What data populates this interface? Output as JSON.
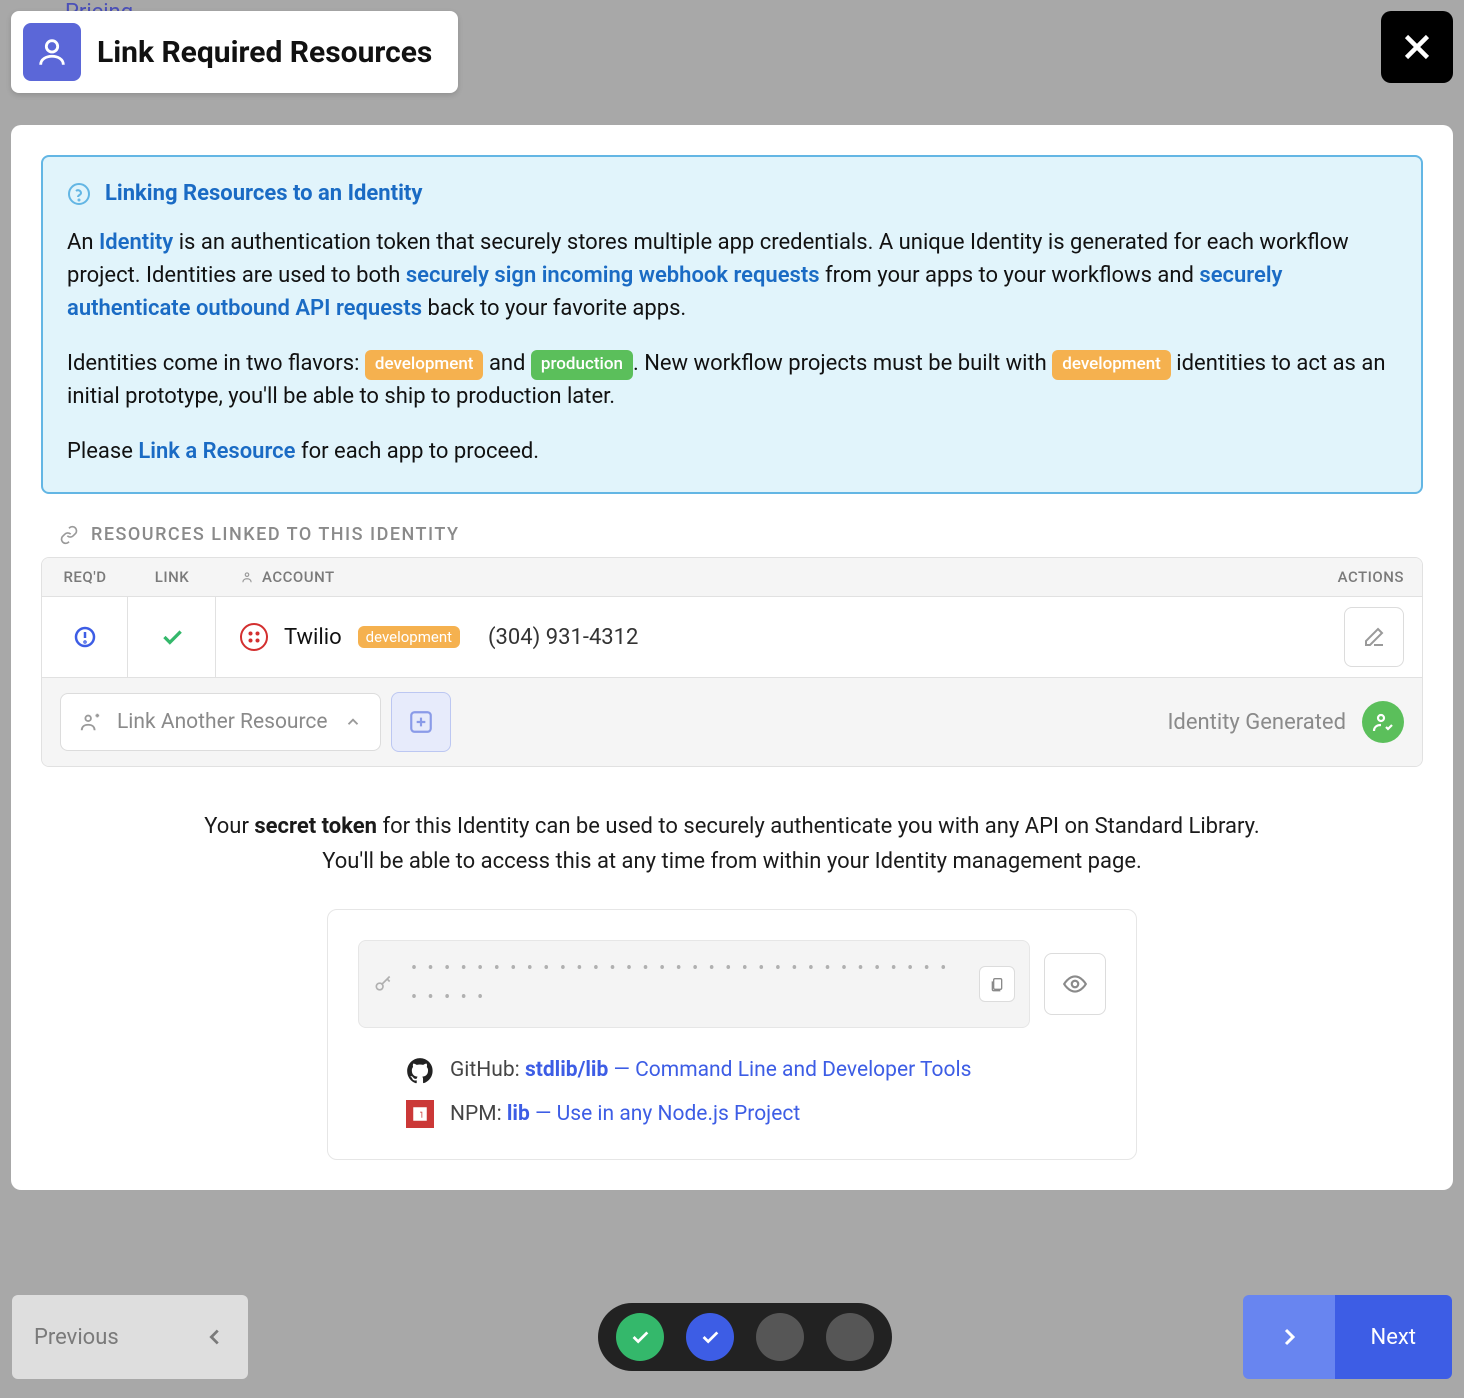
{
  "bg": {
    "pricing": "Pricing"
  },
  "modal": {
    "title": "Link Required Resources"
  },
  "info": {
    "title": "Linking Resources to an Identity",
    "p1_a": "An ",
    "p1_identity": "Identity",
    "p1_b": " is an authentication token that securely stores multiple app credentials. A unique Identity is generated for each workflow project. Identities are used to both ",
    "p1_link1": "securely sign incoming webhook requests",
    "p1_c": " from your apps to your workflows and ",
    "p1_link2": "securely authenticate outbound API requests",
    "p1_d": " back to your favorite apps.",
    "p2_a": "Identities come in two flavors: ",
    "p2_b": " and ",
    "p2_c": ". New workflow projects must be built with ",
    "p2_d": " identities to act as an initial prototype, you'll be able to ship to production later.",
    "p3_a": "Please ",
    "p3_link": "Link a Resource",
    "p3_b": " for each app to proceed.",
    "pill_dev": "development",
    "pill_prod": "production"
  },
  "section": {
    "title": "RESOURCES LINKED TO THIS IDENTITY"
  },
  "table": {
    "headers": {
      "req": "REQ'D",
      "link": "LINK",
      "account": "ACCOUNT",
      "actions": "ACTIONS"
    },
    "rows": [
      {
        "provider": "Twilio",
        "env": "development",
        "value": "(304) 931-4312"
      }
    ]
  },
  "footer_table": {
    "link_another": "Link Another Resource",
    "identity_status": "Identity Generated"
  },
  "token": {
    "line1_a": "Your ",
    "line1_b": "secret token",
    "line1_c": " for this Identity can be used to securely authenticate you with any API on Standard Library.",
    "line2": "You'll be able to access this at any time from within your Identity management page.",
    "mask": "• • • • • • • • • • • • • • • • • • • • • • • • • • • • • • • • • • • • • •",
    "links": [
      {
        "source": "GitHub: ",
        "pkg": "stdlib/lib",
        "sep": " — ",
        "desc": "Command Line and Developer Tools"
      },
      {
        "source": "NPM: ",
        "pkg": "lib",
        "sep": " — ",
        "desc": "Use in any Node.js Project"
      }
    ]
  },
  "nav": {
    "previous": "Previous",
    "next": "Next"
  }
}
